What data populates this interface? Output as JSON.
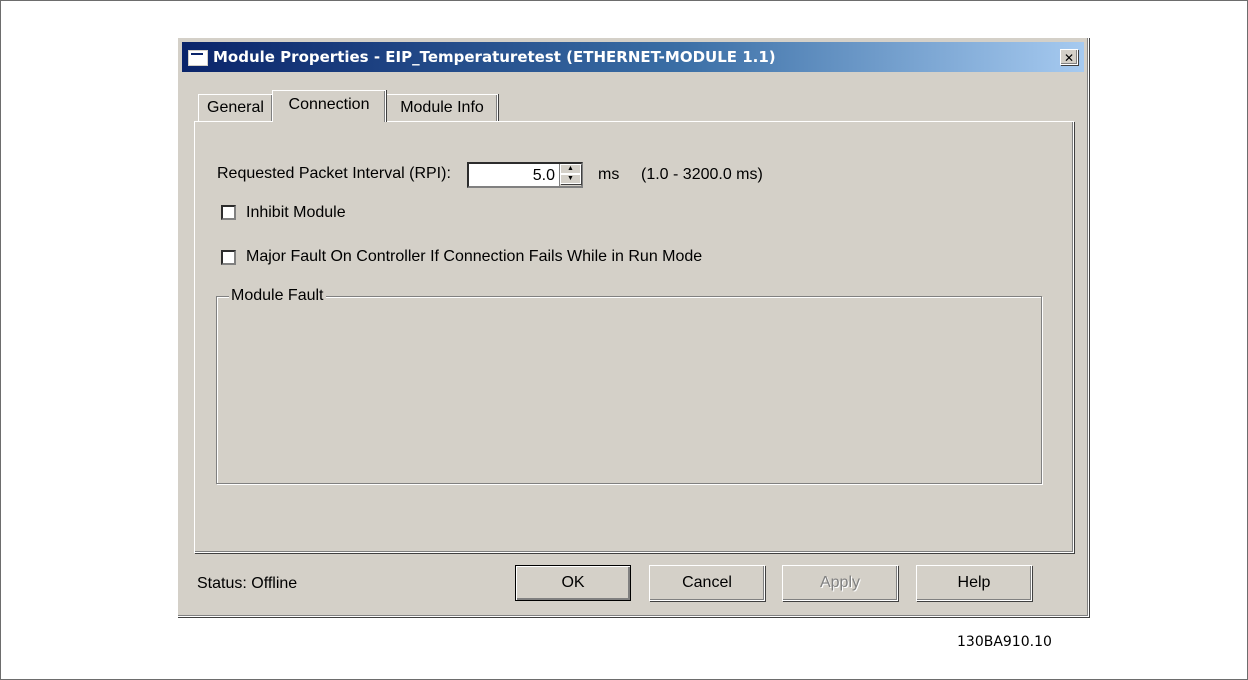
{
  "window": {
    "title": "Module Properties  - EIP_Temperaturetest (ETHERNET-MODULE 1.1)",
    "close_glyph": "✕"
  },
  "tabs": [
    {
      "label": "General",
      "active": false
    },
    {
      "label": "Connection",
      "active": true
    },
    {
      "label": "Module Info",
      "active": false
    }
  ],
  "connection": {
    "rpi_label": "Requested Packet Interval (RPI):",
    "rpi_value": "5.0",
    "rpi_unit": "ms",
    "rpi_range": "(1.0 - 3200.0 ms)",
    "inhibit_label": "Inhibit Module",
    "inhibit_checked": false,
    "major_fault_label": "Major Fault On Controller If Connection Fails While in Run Mode",
    "major_fault_checked": false,
    "module_fault_title": "Module Fault"
  },
  "footer": {
    "status": "Status:  Offline",
    "buttons": {
      "ok": "OK",
      "cancel": "Cancel",
      "apply": "Apply",
      "help": "Help"
    }
  },
  "figure_id": "130BA910.10",
  "colors": {
    "title_start": "#0a246a",
    "title_end": "#a6caf0",
    "face": "#d4d0c8"
  }
}
